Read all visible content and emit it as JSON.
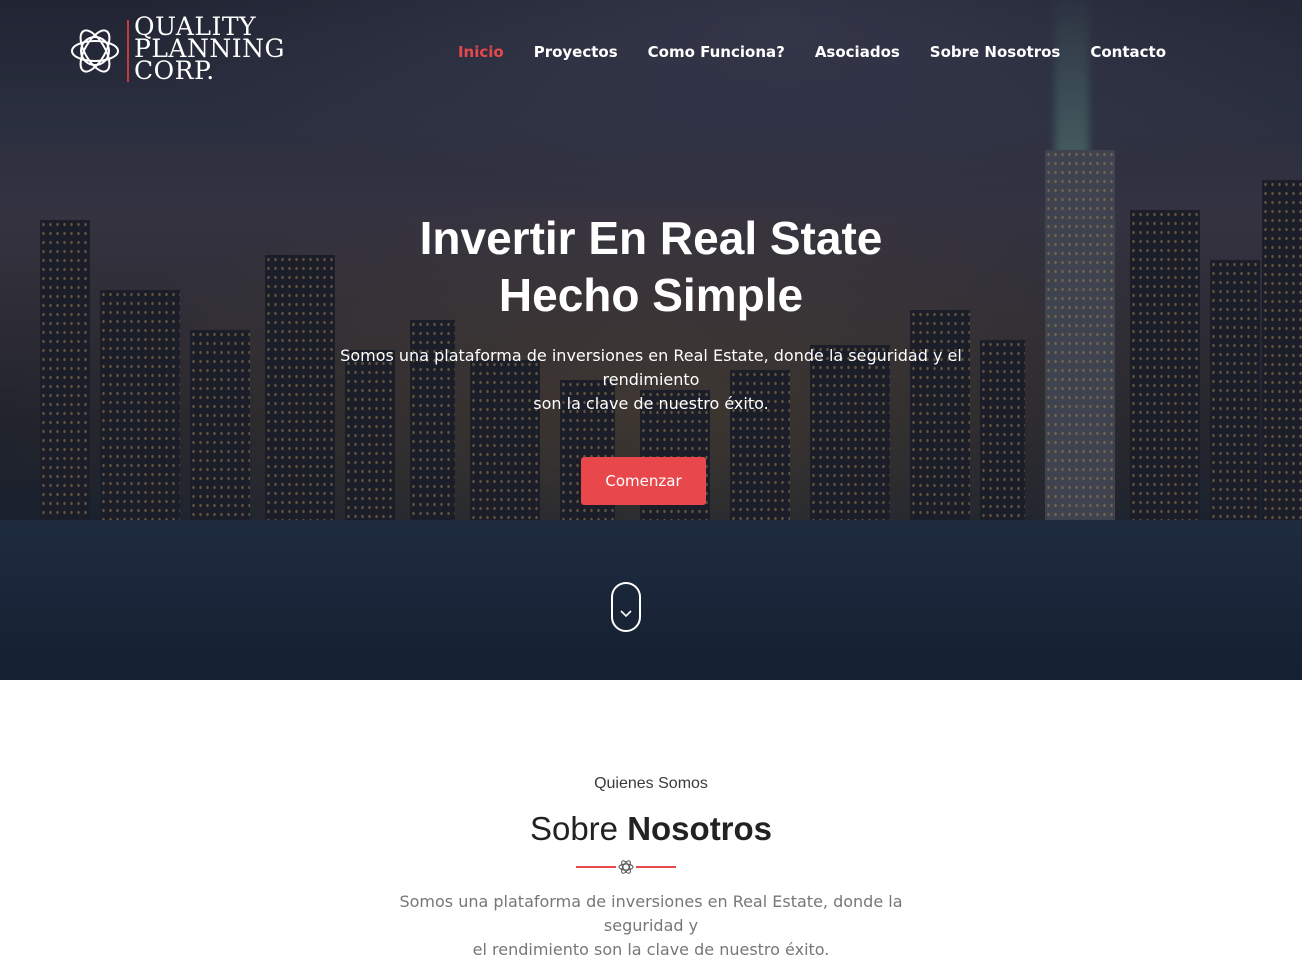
{
  "brand": {
    "lines": [
      "QUALITY",
      "PLANNING",
      "CORP."
    ]
  },
  "nav": {
    "items": [
      {
        "label": "Inicio",
        "active": true
      },
      {
        "label": "Proyectos",
        "active": false
      },
      {
        "label": "Como Funciona?",
        "active": false
      },
      {
        "label": "Asociados",
        "active": false
      },
      {
        "label": "Sobre Nosotros",
        "active": false
      },
      {
        "label": "Contacto",
        "active": false
      }
    ]
  },
  "hero": {
    "title_line1": "Invertir En Real State",
    "title_line2": "Hecho Simple",
    "subtitle_line1": "Somos una plataforma de inversiones en Real Estate, donde la seguridad y el rendimiento",
    "subtitle_line2": "son la clave de nuestro éxito.",
    "cta_label": "Comenzar",
    "scroll_icon": "chevron-down-icon"
  },
  "about": {
    "kicker": "Quienes Somos",
    "title_light": "Sobre",
    "title_bold": "Nosotros",
    "divider_icon": "atom-icon",
    "text_line1": "Somos una plataforma de inversiones en Real Estate, donde la seguridad y",
    "text_line2": "el rendimiento son la clave de nuestro éxito."
  },
  "colors": {
    "accent": "#e8484b",
    "text_muted": "#777777"
  }
}
